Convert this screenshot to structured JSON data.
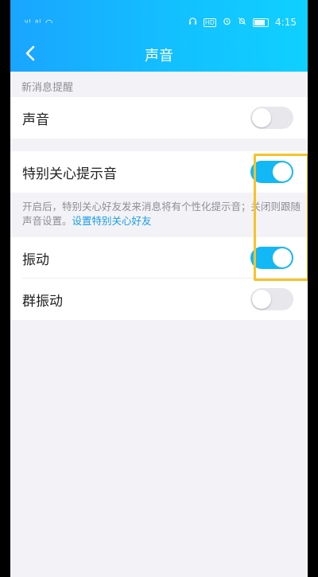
{
  "statusbar": {
    "left_text": "ᵘᴵ ᵃᴵ ◠",
    "time": "4:15",
    "hd_badge": "HD",
    "icons": [
      "headset-icon",
      "alarm-icon",
      "mute-icon",
      "battery-icon"
    ]
  },
  "header": {
    "title": "声音",
    "back_icon": "chevron-left-icon"
  },
  "section": {
    "label": "新消息提醒"
  },
  "rows": {
    "sound": {
      "label": "声音",
      "on": false
    },
    "special_care": {
      "label": "特别关心提示音",
      "on": true
    },
    "vibration": {
      "label": "振动",
      "on": true
    },
    "group_vibration": {
      "label": "群振动",
      "on": false
    }
  },
  "description": {
    "text": "开启后，特别关心好友发来消息将有个性化提示音；关闭则跟随声音设置。",
    "link": "设置特别关心好友"
  },
  "colors": {
    "header_gradient_start": "#1aa5ff",
    "header_gradient_end": "#0fd0ff",
    "toggle_on": "#12b7f5",
    "toggle_off": "#e7e7ec",
    "link": "#1a9ce9",
    "highlight": "#f7c22a"
  }
}
